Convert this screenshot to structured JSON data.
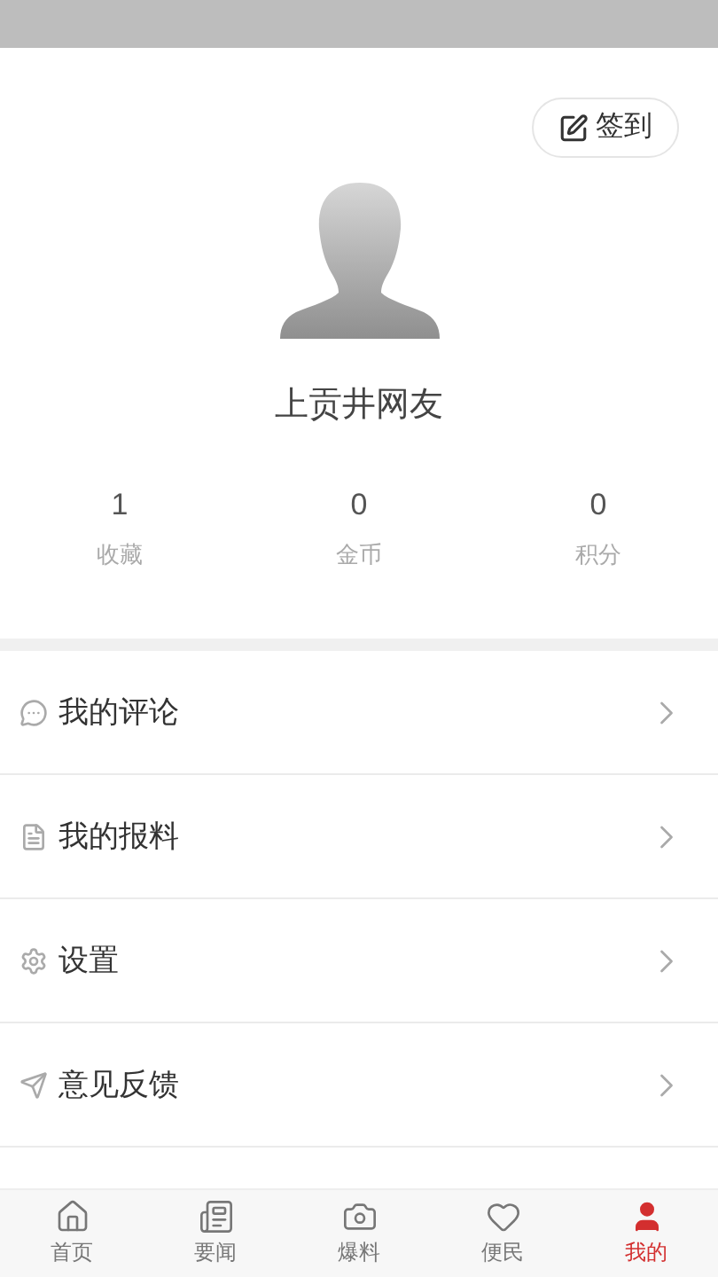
{
  "checkin_button": {
    "label": "签到"
  },
  "profile": {
    "name": "上贡井网友"
  },
  "stats": [
    {
      "value": "1",
      "label": "收藏"
    },
    {
      "value": "0",
      "label": "金币"
    },
    {
      "value": "0",
      "label": "积分"
    }
  ],
  "menu": [
    {
      "kind": "comment",
      "label": "我的评论"
    },
    {
      "kind": "document",
      "label": "我的报料"
    },
    {
      "kind": "settings",
      "label": "设置"
    },
    {
      "kind": "feedback",
      "label": "意见反馈"
    }
  ],
  "nav": [
    {
      "kind": "home",
      "label": "首页",
      "selected": false
    },
    {
      "kind": "news",
      "label": "要闻",
      "selected": false
    },
    {
      "kind": "camera",
      "label": "爆料",
      "selected": false
    },
    {
      "kind": "heart",
      "label": "便民",
      "selected": false
    },
    {
      "kind": "user",
      "label": "我的",
      "selected": true
    }
  ]
}
